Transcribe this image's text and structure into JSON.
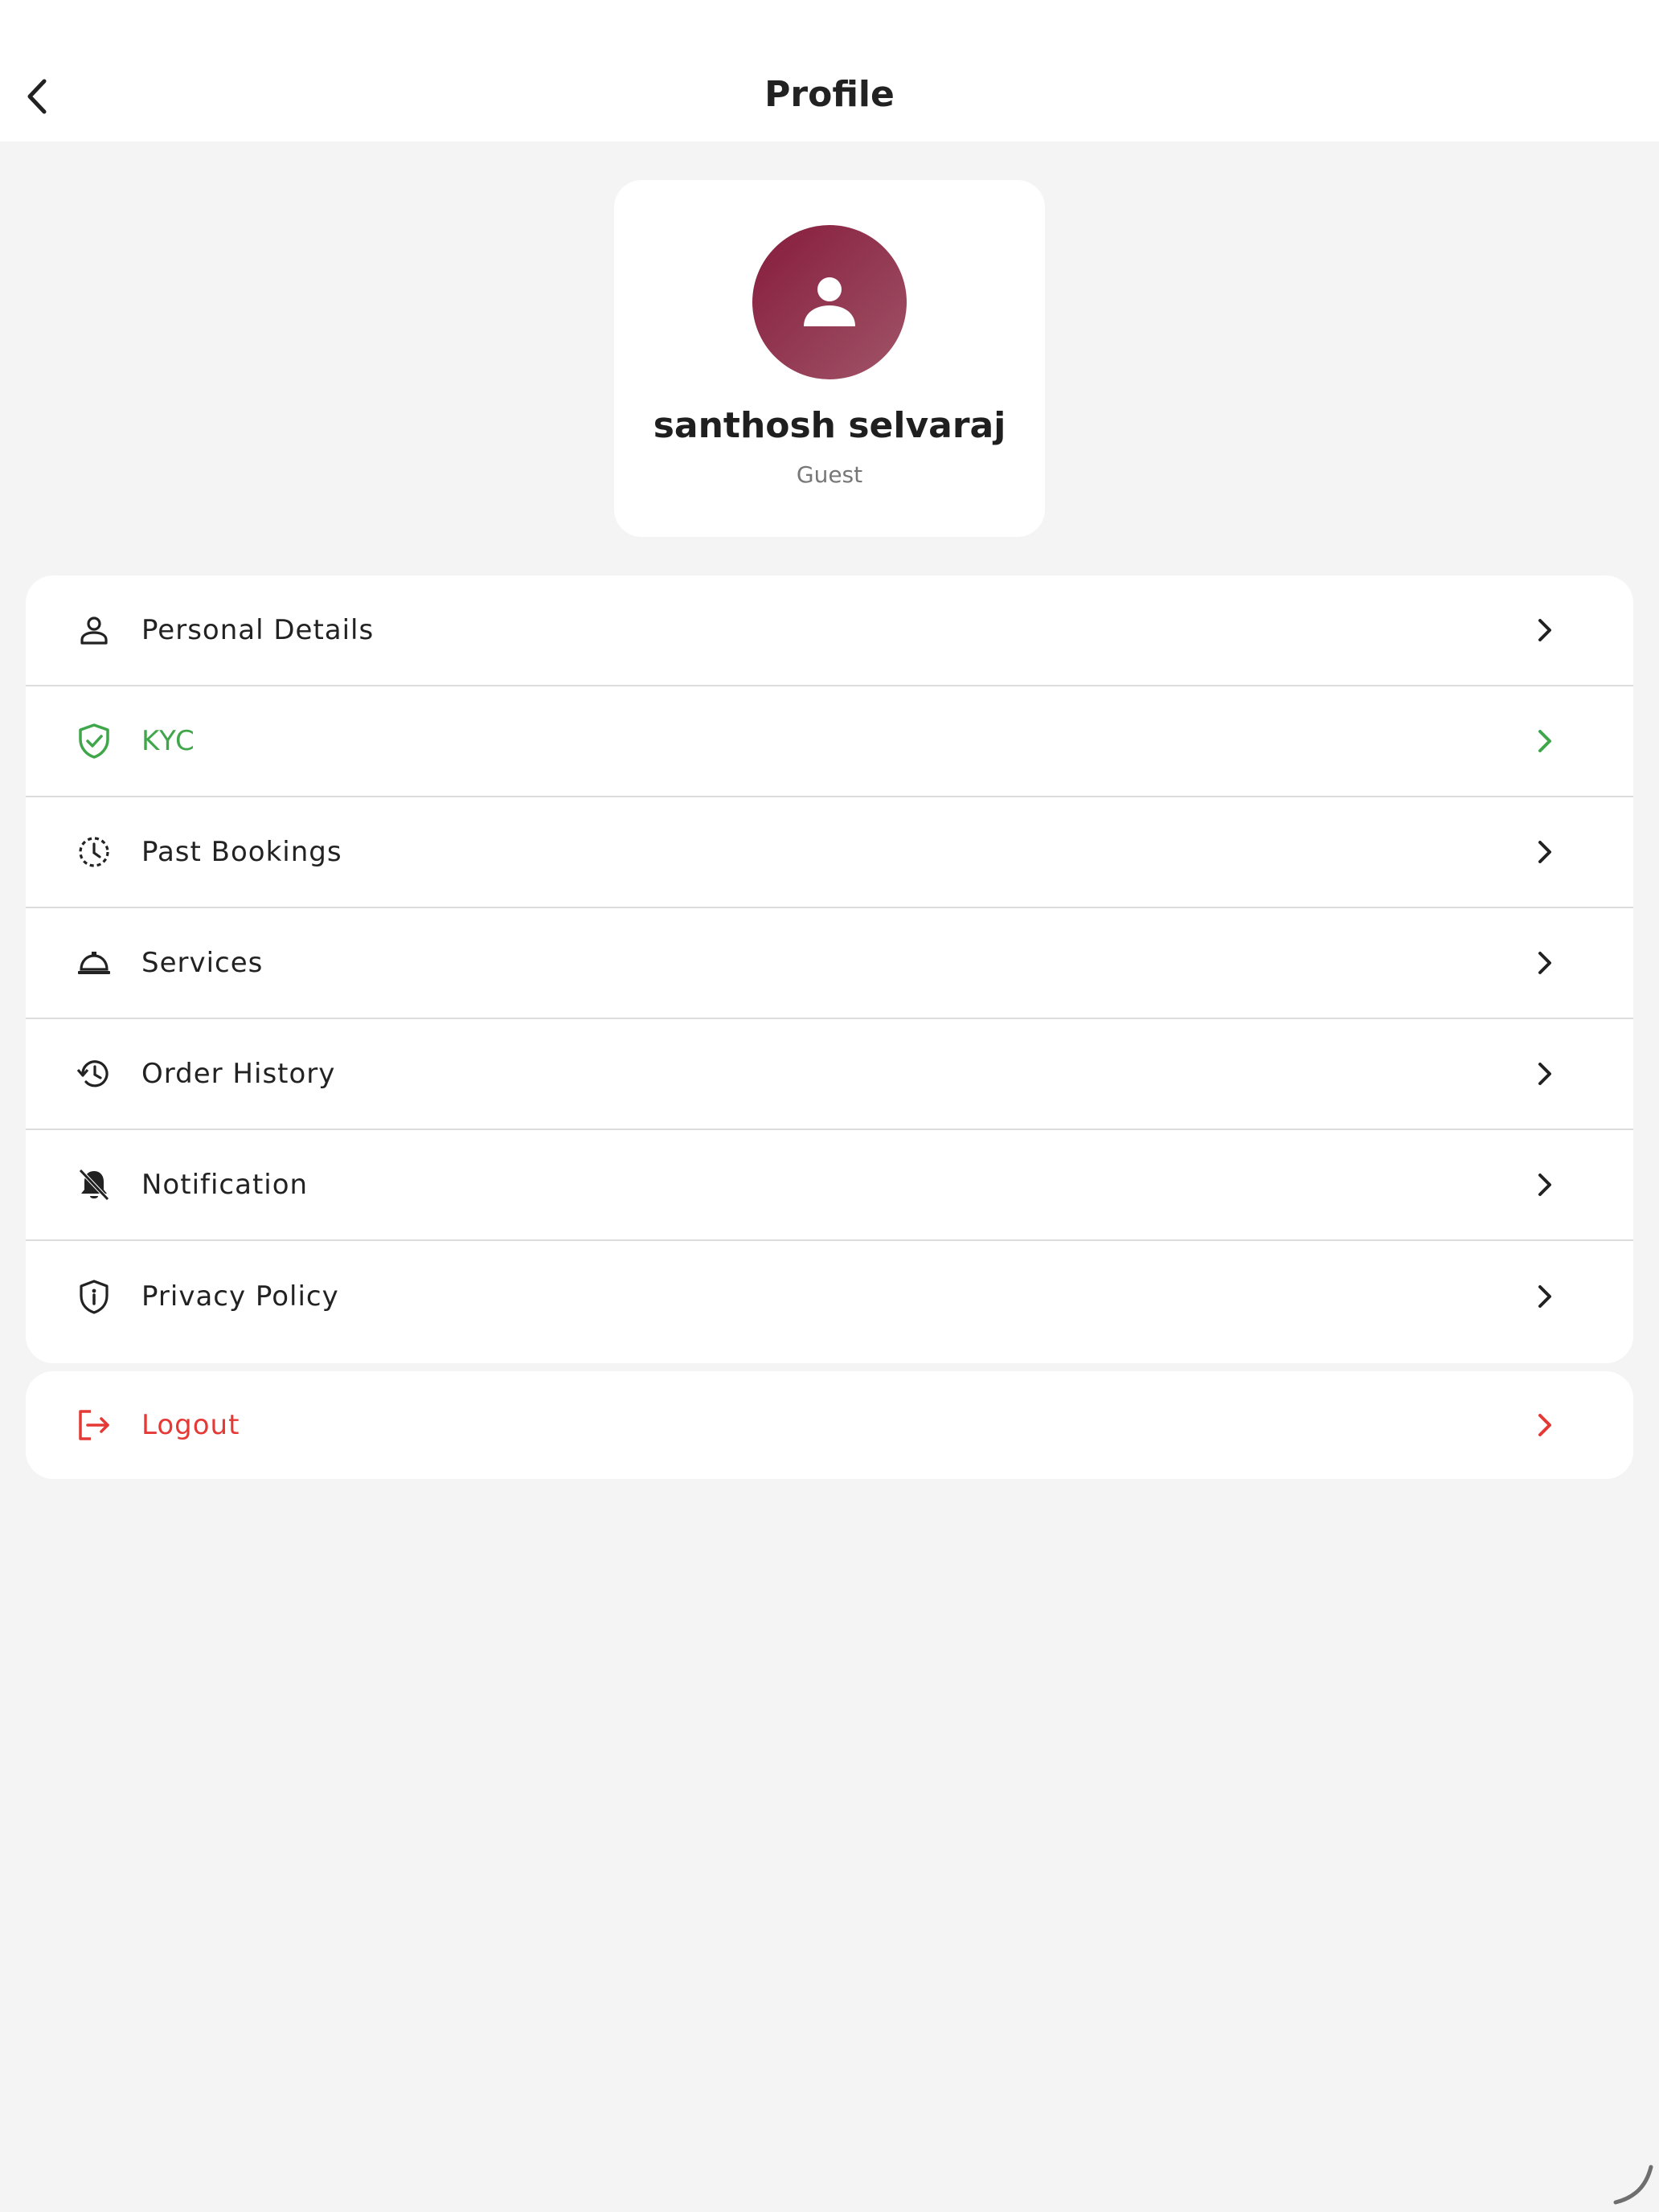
{
  "header": {
    "title": "Profile",
    "back_icon": "chevron-left-icon"
  },
  "profile": {
    "name": "santhosh selvaraj",
    "role": "Guest",
    "avatar_icon": "person-icon",
    "avatar_color": "#8b1f3f"
  },
  "menu": {
    "items": [
      {
        "label": "Personal Details",
        "icon": "person-outline-icon",
        "color": "#222222"
      },
      {
        "label": "KYC",
        "icon": "shield-check-icon",
        "color": "#3fa64a"
      },
      {
        "label": "Past Bookings",
        "icon": "clock-dashed-icon",
        "color": "#222222"
      },
      {
        "label": "Services",
        "icon": "service-bell-icon",
        "color": "#222222"
      },
      {
        "label": "Order History",
        "icon": "history-icon",
        "color": "#222222"
      },
      {
        "label": "Notification",
        "icon": "bell-off-icon",
        "color": "#222222"
      },
      {
        "label": "Privacy Policy",
        "icon": "shield-info-icon",
        "color": "#222222"
      }
    ]
  },
  "logout": {
    "label": "Logout",
    "icon": "logout-icon",
    "color": "#e53935"
  },
  "colors": {
    "background": "#f4f4f4",
    "card": "#ffffff",
    "divider": "#dcdcdc",
    "kyc_green": "#3fa64a",
    "logout_red": "#e53935"
  }
}
